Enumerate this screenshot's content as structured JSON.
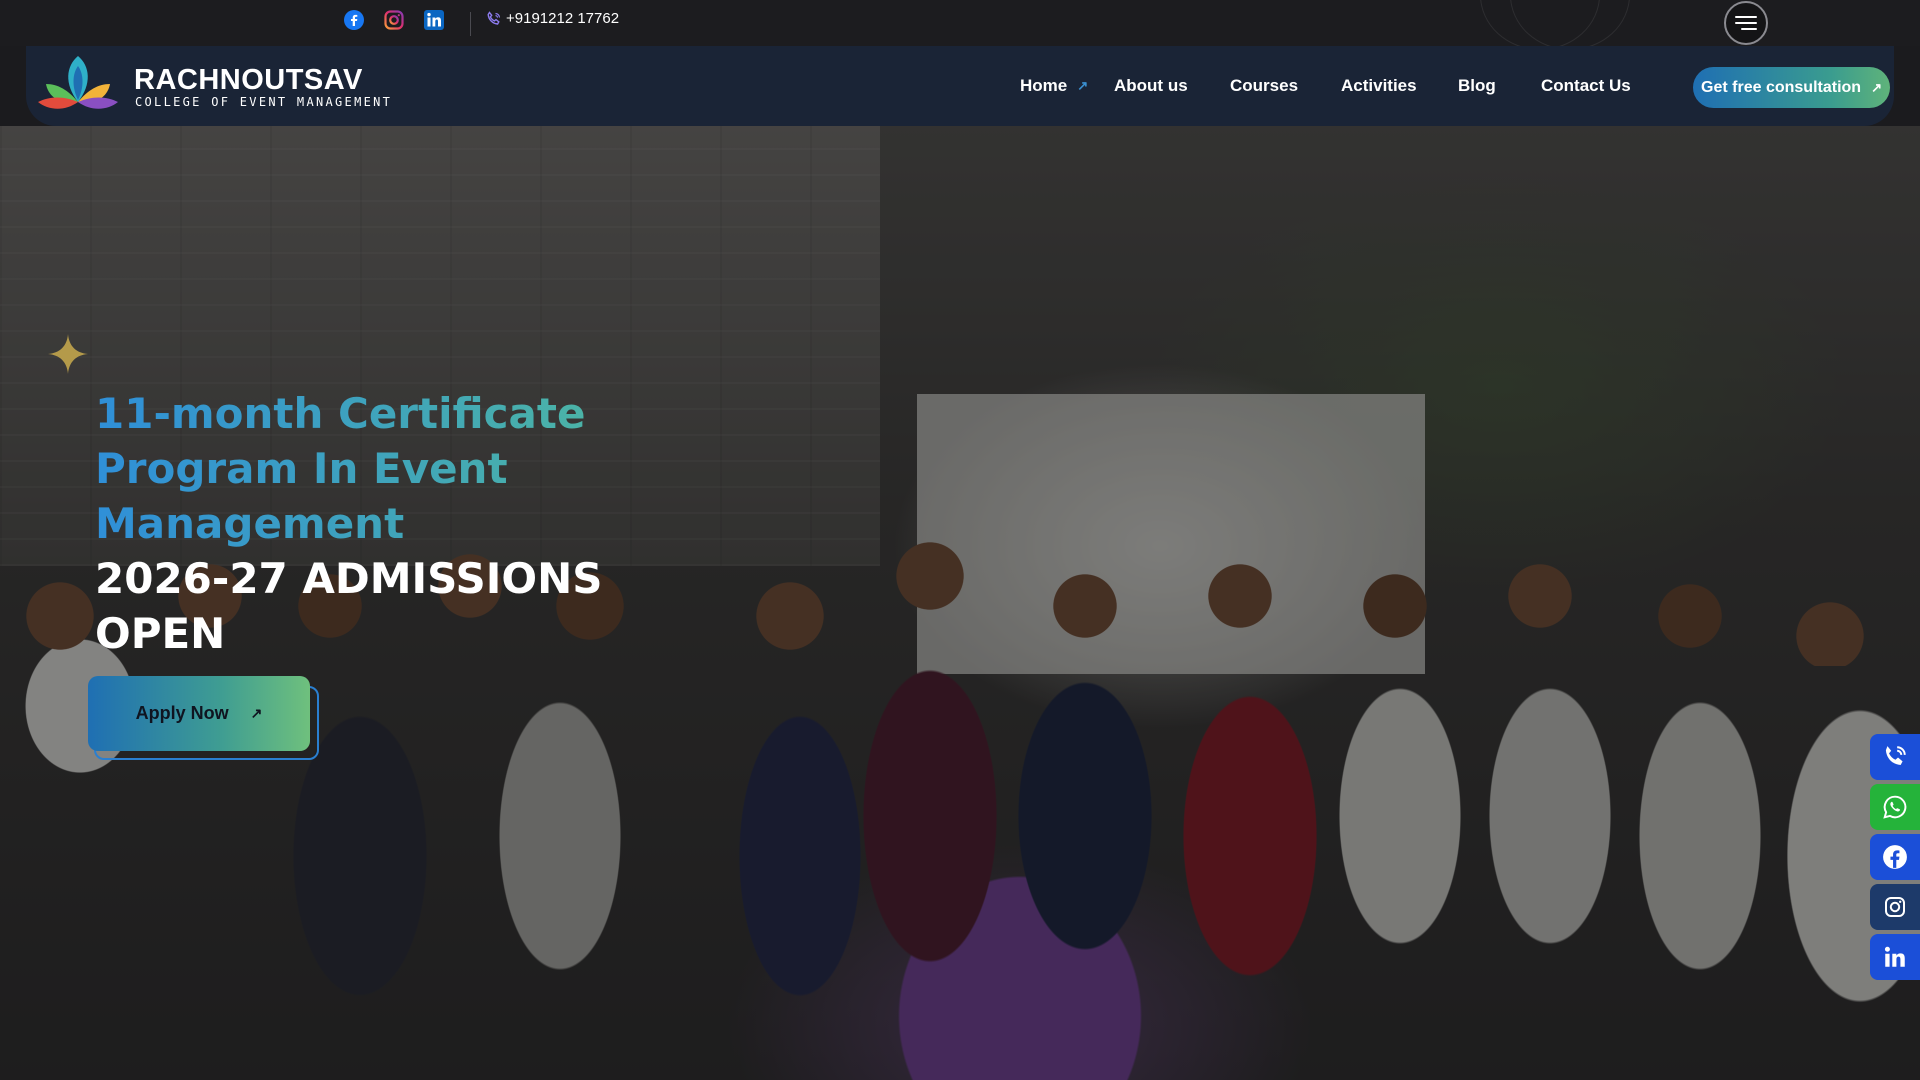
{
  "topbar": {
    "phone": "+9191212 17762",
    "social": [
      "facebook-icon",
      "instagram-icon",
      "linkedin-icon"
    ]
  },
  "brand": {
    "name": "RACHNOUTSAV",
    "tagline": "COLLEGE OF EVENT MANAGEMENT"
  },
  "nav": {
    "items": [
      {
        "label": "Home",
        "icon": "arrow-up-right-icon"
      },
      {
        "label": "About us"
      },
      {
        "label": "Courses"
      },
      {
        "label": "Activities"
      },
      {
        "label": "Blog"
      },
      {
        "label": "Contact Us"
      }
    ],
    "cta_label": "Get free consultation"
  },
  "hero": {
    "heading_line1": "11-month Certificate Program In Event Management",
    "heading_line2": "2026-27 ADMISSIONS OPEN",
    "apply_label": "Apply Now"
  },
  "float_buttons": [
    {
      "icon": "phone-icon",
      "color": "#1b4fd8"
    },
    {
      "icon": "whatsapp-icon",
      "color": "#25b33a"
    },
    {
      "icon": "facebook-icon",
      "color": "#1b4fd8"
    },
    {
      "icon": "instagram-icon",
      "color": "#1d3a6a"
    },
    {
      "icon": "linkedin-icon",
      "color": "#1b4fd8"
    }
  ],
  "colors": {
    "accent_blue": "#1f6fb3",
    "accent_green": "#5fb37a",
    "nav_bg": "#1a2436",
    "topbar_bg": "#1c1c1f"
  }
}
